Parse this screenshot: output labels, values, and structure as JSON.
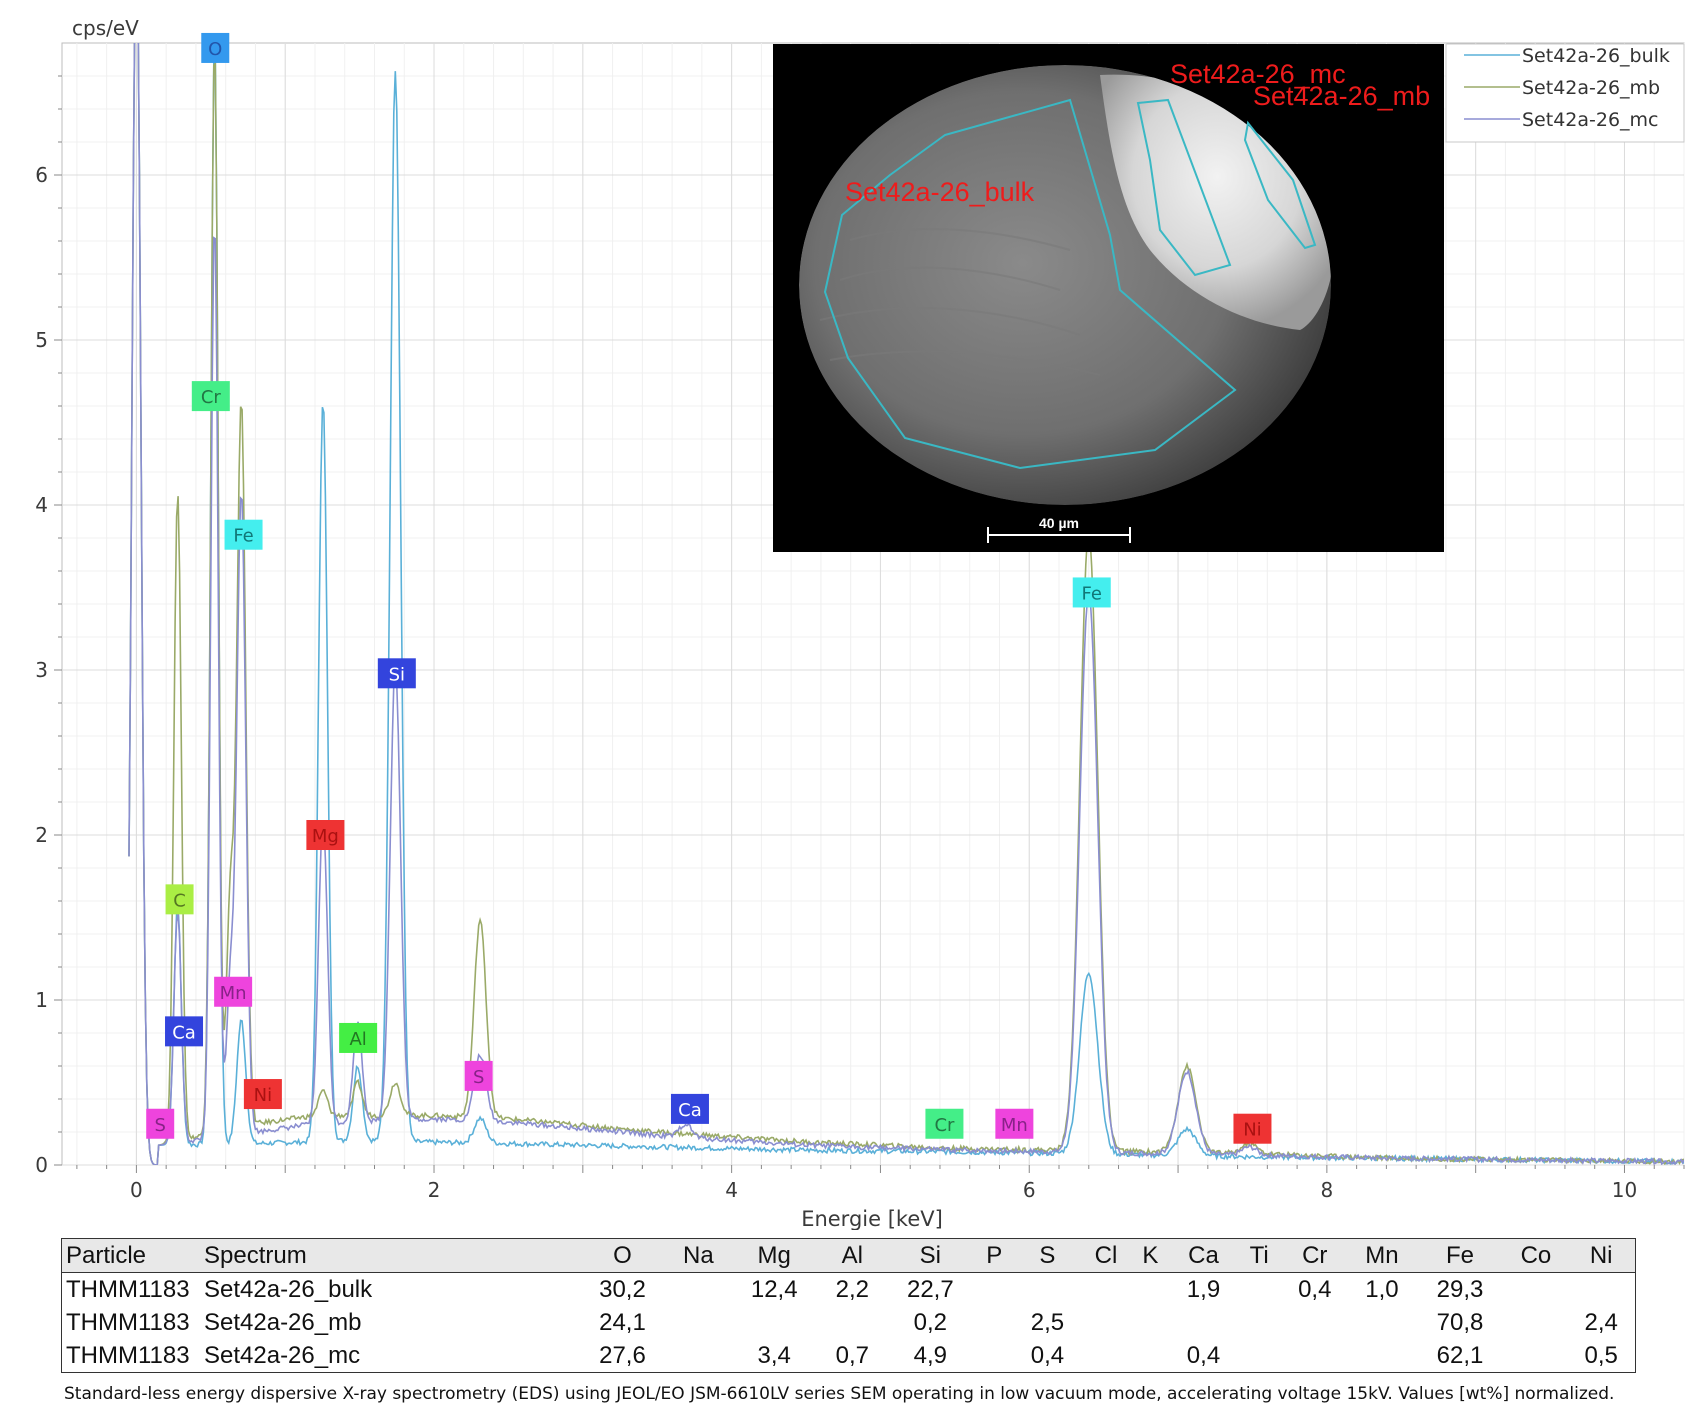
{
  "chart_data": {
    "type": "line",
    "title": "",
    "xlabel": "Energie [keV]",
    "ylabel": "cps/eV",
    "xlim": [
      -0.5,
      10.4
    ],
    "ylim": [
      0,
      6.8
    ],
    "x_ticks": [
      0,
      2,
      4,
      6,
      8,
      10
    ],
    "y_ticks": [
      0,
      1,
      2,
      3,
      4,
      5,
      6
    ],
    "grid": true,
    "legend_position": "top-right",
    "series": [
      {
        "name": "Set42a-26_bulk",
        "color": "#5ab0d8",
        "baseline": [
          [
            0.15,
            0.12
          ],
          [
            0.8,
            0.13
          ],
          [
            1.5,
            0.15
          ],
          [
            1.9,
            0.14
          ],
          [
            2.5,
            0.13
          ],
          [
            3.5,
            0.11
          ],
          [
            4.5,
            0.09
          ],
          [
            5.5,
            0.08
          ],
          [
            6.2,
            0.07
          ],
          [
            7.5,
            0.05
          ],
          [
            8.5,
            0.04
          ],
          [
            10.4,
            0.02
          ]
        ],
        "peaks": [
          [
            0.0,
            7.5,
            0.03
          ],
          [
            0.277,
            1.45,
            0.025
          ],
          [
            0.525,
            6.7,
            0.025
          ],
          [
            0.705,
            0.75,
            0.03
          ],
          [
            1.254,
            4.5,
            0.03
          ],
          [
            1.487,
            0.45,
            0.03
          ],
          [
            1.74,
            6.5,
            0.035
          ],
          [
            2.31,
            0.15,
            0.04
          ],
          [
            6.4,
            1.1,
            0.06
          ],
          [
            7.06,
            0.16,
            0.06
          ]
        ]
      },
      {
        "name": "Set42a-26_mb",
        "color": "#9aaa68",
        "baseline": [
          [
            0.15,
            0.12
          ],
          [
            0.8,
            0.25
          ],
          [
            1.2,
            0.3
          ],
          [
            2.0,
            0.3
          ],
          [
            2.5,
            0.28
          ],
          [
            3.5,
            0.2
          ],
          [
            4.5,
            0.14
          ],
          [
            5.5,
            0.1
          ],
          [
            6.2,
            0.09
          ],
          [
            7.5,
            0.07
          ],
          [
            8.5,
            0.04
          ],
          [
            10.4,
            0.02
          ]
        ],
        "peaks": [
          [
            0.0,
            7.5,
            0.03
          ],
          [
            0.277,
            3.95,
            0.025
          ],
          [
            0.525,
            6.6,
            0.025
          ],
          [
            0.63,
            1.35,
            0.025
          ],
          [
            0.705,
            4.4,
            0.03
          ],
          [
            1.254,
            0.15,
            0.03
          ],
          [
            1.487,
            0.2,
            0.03
          ],
          [
            1.74,
            0.2,
            0.035
          ],
          [
            2.31,
            1.2,
            0.04
          ],
          [
            6.4,
            3.75,
            0.06
          ],
          [
            7.06,
            0.52,
            0.06
          ],
          [
            7.48,
            0.06,
            0.05
          ]
        ]
      },
      {
        "name": "Set42a-26_mc",
        "color": "#8a8ed0",
        "baseline": [
          [
            0.15,
            0.12
          ],
          [
            0.8,
            0.2
          ],
          [
            1.2,
            0.25
          ],
          [
            2.0,
            0.28
          ],
          [
            2.5,
            0.26
          ],
          [
            3.5,
            0.18
          ],
          [
            4.5,
            0.12
          ],
          [
            5.5,
            0.09
          ],
          [
            6.2,
            0.08
          ],
          [
            7.5,
            0.06
          ],
          [
            8.5,
            0.04
          ],
          [
            10.4,
            0.02
          ]
        ],
        "peaks": [
          [
            0.0,
            7.5,
            0.03
          ],
          [
            0.277,
            1.4,
            0.025
          ],
          [
            0.525,
            5.55,
            0.025
          ],
          [
            0.63,
            0.9,
            0.025
          ],
          [
            0.705,
            3.9,
            0.03
          ],
          [
            1.254,
            1.85,
            0.03
          ],
          [
            1.487,
            0.6,
            0.03
          ],
          [
            1.74,
            2.75,
            0.035
          ],
          [
            2.31,
            0.4,
            0.04
          ],
          [
            3.69,
            0.08,
            0.04
          ],
          [
            6.4,
            3.4,
            0.06
          ],
          [
            7.06,
            0.5,
            0.06
          ],
          [
            7.48,
            0.05,
            0.05
          ]
        ]
      }
    ],
    "peak_labels": [
      {
        "text": "O",
        "x": 0.53,
        "y": 6.77,
        "color": "#3399ee",
        "text_color": "#2255aa"
      },
      {
        "text": "Cr",
        "x": 0.5,
        "y": 4.66,
        "color": "#44ee88",
        "text_color": "#227744"
      },
      {
        "text": "Fe",
        "x": 0.72,
        "y": 3.82,
        "color": "#44eeee",
        "text_color": "#117777"
      },
      {
        "text": "Si",
        "x": 1.75,
        "y": 2.98,
        "color": "#3344dd",
        "text_color": "#ffffff"
      },
      {
        "text": "Mg",
        "x": 1.27,
        "y": 2.0,
        "color": "#ee3333",
        "text_color": "#aa1111"
      },
      {
        "text": "C",
        "x": 0.29,
        "y": 1.61,
        "color": "#aaee44",
        "text_color": "#557722"
      },
      {
        "text": "Mn",
        "x": 0.65,
        "y": 1.05,
        "color": "#ee44dd",
        "text_color": "#882288"
      },
      {
        "text": "Ca",
        "x": 0.32,
        "y": 0.81,
        "color": "#3344dd",
        "text_color": "#ffffff"
      },
      {
        "text": "Al",
        "x": 1.49,
        "y": 0.77,
        "color": "#44ee44",
        "text_color": "#227722"
      },
      {
        "text": "S",
        "x": 2.3,
        "y": 0.54,
        "color": "#ee44dd",
        "text_color": "#882288"
      },
      {
        "text": "Ni",
        "x": 0.85,
        "y": 0.43,
        "color": "#ee3333",
        "text_color": "#aa1111"
      },
      {
        "text": "S",
        "x": 0.16,
        "y": 0.25,
        "color": "#ee44dd",
        "text_color": "#882288"
      },
      {
        "text": "Ca",
        "x": 3.72,
        "y": 0.34,
        "color": "#3344dd",
        "text_color": "#ffffff"
      },
      {
        "text": "Cr",
        "x": 5.43,
        "y": 0.25,
        "color": "#44ee88",
        "text_color": "#227744"
      },
      {
        "text": "Mn",
        "x": 5.9,
        "y": 0.25,
        "color": "#ee44dd",
        "text_color": "#882288"
      },
      {
        "text": "Fe",
        "x": 6.42,
        "y": 3.47,
        "color": "#44eeee",
        "text_color": "#117777"
      },
      {
        "text": "Ni",
        "x": 7.5,
        "y": 0.22,
        "color": "#ee3333",
        "text_color": "#aa1111"
      }
    ]
  },
  "sem_image": {
    "labels": [
      "Set42a-26_mc",
      "Set42a-26_mb",
      "Set42a-26_bulk"
    ],
    "scale_bar": "40 µm"
  },
  "table": {
    "headers": [
      "Particle",
      "Spectrum",
      "O",
      "Na",
      "Mg",
      "Al",
      "Si",
      "P",
      "S",
      "Cl",
      "K",
      "Ca",
      "Ti",
      "Cr",
      "Mn",
      "Fe",
      "Co",
      "Ni"
    ],
    "rows": [
      [
        "THMM1183",
        "Set42a-26_bulk",
        "30,2",
        "",
        "12,4",
        "2,2",
        "22,7",
        "",
        "",
        "",
        "",
        "1,9",
        "",
        "0,4",
        "1,0",
        "29,3",
        "",
        ""
      ],
      [
        "THMM1183",
        "Set42a-26_mb",
        "24,1",
        "",
        "",
        "",
        "0,2",
        "",
        "2,5",
        "",
        "",
        "",
        "",
        "",
        "",
        "70,8",
        "",
        "2,4"
      ],
      [
        "THMM1183",
        "Set42a-26_mc",
        "27,6",
        "",
        "3,4",
        "0,7",
        "4,9",
        "",
        "0,4",
        "",
        "",
        "0,4",
        "",
        "",
        "",
        "62,1",
        "",
        "0,5"
      ]
    ]
  },
  "caption": "Standard-less energy dispersive X-ray spectrometry (EDS) using JEOL/EO JSM-6610LV series SEM operating in low vacuum mode, accelerating voltage 15kV. Values [wt%] normalized."
}
